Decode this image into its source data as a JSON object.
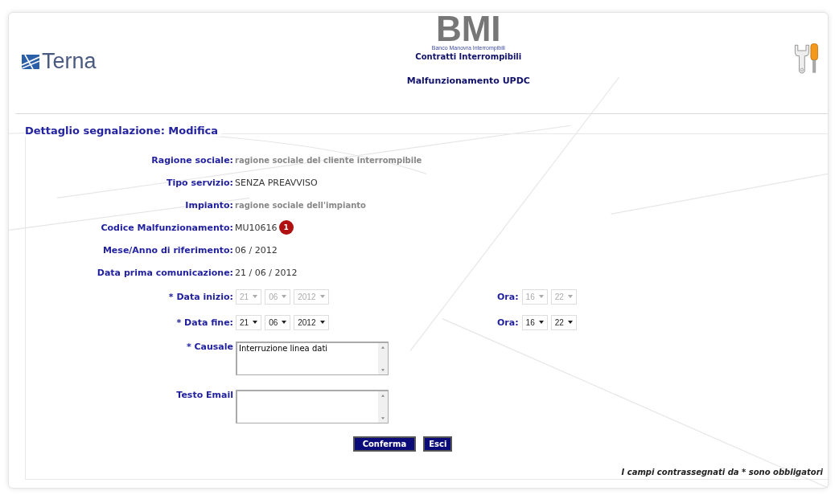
{
  "header": {
    "logo_text": "Terna",
    "app_title": "BMI",
    "app_subtitle": "Banco Manovra Interrompibili",
    "module": "Contratti Interrompibili",
    "page_title": "Malfunzionamento UPDC"
  },
  "section_title": "Dettaglio segnalazione: Modifica",
  "info_rows": [
    {
      "label": "Ragione sociale:",
      "value": "ragione sociale del cliente interrompibile",
      "kind": "muted"
    },
    {
      "label": "Tipo servizio:",
      "value": "SENZA PREAVVISO",
      "kind": "plain"
    },
    {
      "label": "Impianto:",
      "value": "ragione sociale dell'impianto",
      "kind": "muted"
    },
    {
      "label": "Codice Malfunzionamento:",
      "value": "MU10616",
      "kind": "plain",
      "badge": "1"
    },
    {
      "label": "Mese/Anno di riferimento:",
      "value": "06 / 2012",
      "kind": "plain"
    },
    {
      "label": "Data prima comunicazione:",
      "value": "21 / 06 / 2012",
      "kind": "plain"
    }
  ],
  "date_rows": [
    {
      "label": "* Data inizio:",
      "disabled": true,
      "date": [
        "21",
        "06",
        "2012"
      ],
      "time_label": "Ora:",
      "time": [
        "16",
        "22"
      ]
    },
    {
      "label": "* Data fine:",
      "disabled": false,
      "date": [
        "21",
        "06",
        "2012"
      ],
      "time_label": "Ora:",
      "time": [
        "16",
        "22"
      ]
    }
  ],
  "text_areas": [
    {
      "label": "* Causale",
      "value": "Interruzione linea dati"
    },
    {
      "label": "Testo Email"
    }
  ],
  "buttons": [
    "Conferma",
    "Esci"
  ],
  "footnote": "I campi contrassegnati da * sono obbligatori"
}
